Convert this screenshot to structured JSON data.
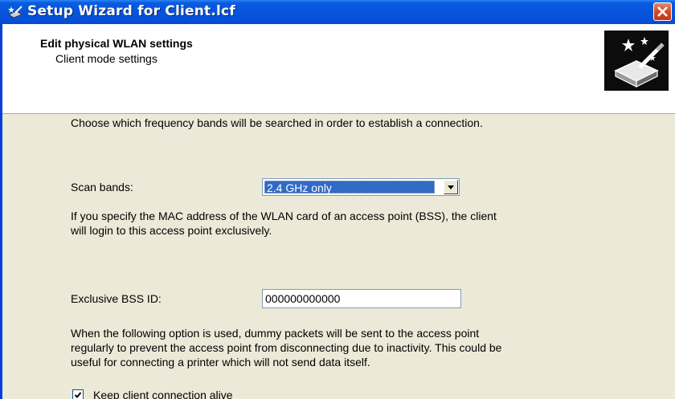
{
  "window": {
    "title": "Setup Wizard for Client.lcf",
    "app_icon": "wizard-wand-icon",
    "close_icon": "close-icon"
  },
  "header": {
    "title": "Edit physical WLAN settings",
    "subtitle": "Client mode settings",
    "image_icon": "wizard-router-sparkle-icon"
  },
  "content": {
    "scan_intro": "Choose which frequency bands will be searched in order to establish a connection.",
    "scan_label": "Scan bands:",
    "scan_value": "2.4 GHz only",
    "bss_desc_line1": "If you specify the MAC address of the WLAN card of an access point (BSS), the client",
    "bss_desc_line2": "will login to this access point exclusively.",
    "bss_label": "Exclusive BSS ID:",
    "bss_value": "000000000000",
    "keepalive_desc_line1": "When the following option is used, dummy packets will be sent to the access point",
    "keepalive_desc_line2": "regularly to prevent the access point from disconnecting due to inactivity. This could be",
    "keepalive_desc_line3": "useful for connecting a printer which will not send data itself.",
    "keepalive_label": "Keep client connection alive",
    "keepalive_checked": true
  },
  "colors": {
    "titlebar_blue": "#0654dc",
    "selection_blue": "#316ac5",
    "dialog_bg": "#ece9d8",
    "close_red": "#d44a22"
  }
}
